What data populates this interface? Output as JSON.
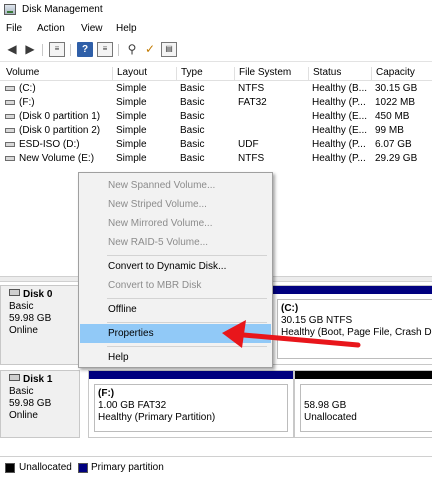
{
  "window": {
    "title": "Disk Management"
  },
  "menu": [
    "File",
    "Action",
    "View",
    "Help"
  ],
  "toolbar": {
    "icons": [
      "back-arrow-icon",
      "forward-arrow-icon",
      "volume-list-icon",
      "help-icon",
      "disk-list-icon",
      "connect-icon",
      "check-icon",
      "properties-icon"
    ],
    "help_glyph": "?"
  },
  "columns": [
    "Volume",
    "Layout",
    "Type",
    "File System",
    "Status",
    "Capacity"
  ],
  "volumes": [
    [
      "(C:)",
      "Simple",
      "Basic",
      "NTFS",
      "Healthy (B...",
      "30.15 GB"
    ],
    [
      "(F:)",
      "Simple",
      "Basic",
      "FAT32",
      "Healthy (P...",
      "1022 MB"
    ],
    [
      "(Disk 0 partition 1)",
      "Simple",
      "Basic",
      "",
      "Healthy (E...",
      "450 MB"
    ],
    [
      "(Disk 0 partition 2)",
      "Simple",
      "Basic",
      "",
      "Healthy (E...",
      "99 MB"
    ],
    [
      "ESD-ISO (D:)",
      "Simple",
      "Basic",
      "UDF",
      "Healthy (P...",
      "6.07 GB"
    ],
    [
      "New Volume (E:)",
      "Simple",
      "Basic",
      "NTFS",
      "Healthy (P...",
      "29.29 GB"
    ]
  ],
  "disks": [
    {
      "name": "Disk 0",
      "type": "Basic",
      "size": "59.98 GB",
      "status": "Online",
      "partitions": [
        {
          "name": "(C:)",
          "detail": "30.15 GB NTFS",
          "health": "Healthy (Boot, Page File, Crash Dur",
          "bar_color": "#00007f"
        }
      ]
    },
    {
      "name": "Disk 1",
      "type": "Basic",
      "size": "59.98 GB",
      "status": "Online",
      "partitions": [
        {
          "name": "(F:)",
          "detail": "1.00 GB FAT32",
          "health": "Healthy (Primary Partition)",
          "bar_color": "#00007f"
        },
        {
          "name": "",
          "detail": "58.98 GB",
          "health": "Unallocated",
          "bar_color": "#000000"
        }
      ]
    }
  ],
  "context_menu": {
    "items": [
      {
        "label": "New Spanned Volume...",
        "enabled": false
      },
      {
        "label": "New Striped Volume...",
        "enabled": false
      },
      {
        "label": "New Mirrored Volume...",
        "enabled": false
      },
      {
        "label": "New RAID-5 Volume...",
        "enabled": false
      },
      {
        "label": "Convert to Dynamic Disk...",
        "enabled": true
      },
      {
        "label": "Convert to MBR Disk",
        "enabled": false
      },
      {
        "label": "Offline",
        "enabled": true
      },
      {
        "label": "Properties",
        "enabled": true,
        "highlighted": true
      },
      {
        "label": "Help",
        "enabled": true
      }
    ]
  },
  "legend": [
    {
      "label": "Unallocated",
      "color": "#000000"
    },
    {
      "label": "Primary partition",
      "color": "#00007f"
    }
  ],
  "annotation": {
    "arrow_color": "#e8161b"
  }
}
